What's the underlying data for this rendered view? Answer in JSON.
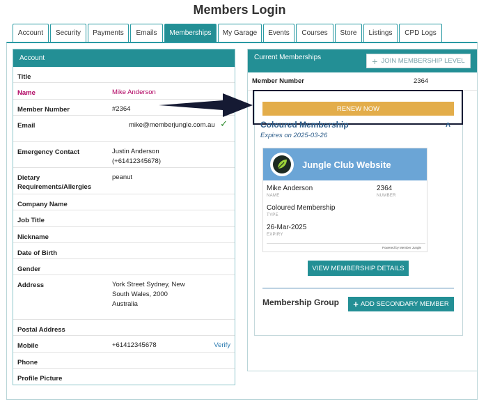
{
  "page": {
    "title": "Members Login"
  },
  "tabs": [
    {
      "label": "Account"
    },
    {
      "label": "Security"
    },
    {
      "label": "Payments"
    },
    {
      "label": "Emails"
    },
    {
      "label": "Memberships",
      "active": true
    },
    {
      "label": "My Garage"
    },
    {
      "label": "Events"
    },
    {
      "label": "Courses"
    },
    {
      "label": "Store"
    },
    {
      "label": "Listings"
    },
    {
      "label": "CPD Logs"
    }
  ],
  "account": {
    "header": "Account",
    "rows": [
      {
        "label": "Title",
        "value": ""
      },
      {
        "label": "Name",
        "value": "Mike Anderson"
      },
      {
        "label": "Member Number",
        "value": "#2364"
      },
      {
        "label": "Email",
        "value": "mike@memberjungle.com.au"
      },
      {
        "label": "Emergency Contact",
        "value": "Justin Anderson (+61412345678)"
      },
      {
        "label": "Dietary Requirements/Allergies",
        "value": "peanut"
      },
      {
        "label": "Company Name",
        "value": ""
      },
      {
        "label": "Job Title",
        "value": ""
      },
      {
        "label": "Nickname",
        "value": ""
      },
      {
        "label": "Date of Birth",
        "value": ""
      },
      {
        "label": "Gender",
        "value": ""
      },
      {
        "label": "Address",
        "value": "York Street Sydney, New South Wales, 2000 Australia"
      },
      {
        "label": "Postal Address",
        "value": ""
      },
      {
        "label": "Mobile",
        "value": "+61412345678",
        "action": "Verify"
      },
      {
        "label": "Phone",
        "value": ""
      },
      {
        "label": "Profile Picture",
        "value": ""
      }
    ]
  },
  "memberships": {
    "header": "Current Memberships",
    "join_label": "JOIN MEMBERSHIP LEVEL",
    "member_number_label": "Member Number",
    "member_number": "2364",
    "renew_label": "RENEW NOW",
    "membership_name": "Coloured Membership",
    "expires": "Expires on 2025-03-26",
    "card": {
      "club_name": "Jungle Club Website",
      "name": "Mike Anderson",
      "name_caption": "NAME",
      "number": "2364",
      "number_caption": "NUMBER",
      "type": "Coloured Membership",
      "type_caption": "TYPE",
      "expiry": "26-Mar-2025",
      "expiry_caption": "EXPIRY",
      "powered_by": "Powered by Member Jungle"
    },
    "view_details_label": "VIEW MEMBERSHIP DETAILS",
    "group_label": "Membership Group",
    "add_secondary_label": "ADD SECONDARY MEMBER"
  },
  "colors": {
    "accent": "#238f95",
    "renew": "#e3ad4a",
    "card_header": "#6ba5d6",
    "annotation": "#151a33"
  }
}
